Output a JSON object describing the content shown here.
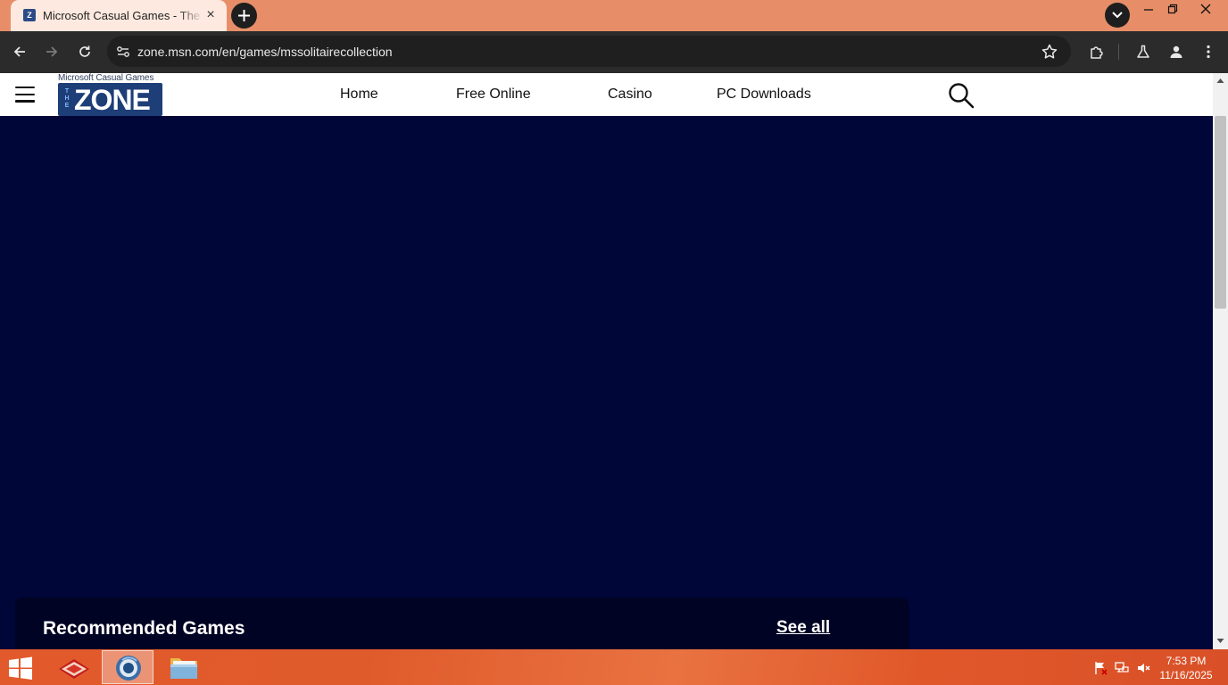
{
  "browser": {
    "tab_title": "Microsoft Casual Games - The Zone",
    "url": "zone.msn.com/en/games/mssolitairecollection"
  },
  "site": {
    "logo_top": "Microsoft Casual Games",
    "logo_the": "THE",
    "logo_zone": "ZONE",
    "nav": [
      "Home",
      "Free Online",
      "Casino",
      "PC Downloads"
    ]
  },
  "content": {
    "section_title": "Recommended Games",
    "see_all": "See all"
  },
  "taskbar": {
    "time": "7:53 PM",
    "date": "11/16/2025"
  },
  "colors": {
    "tab_strip": "#e78e69",
    "page_background": "#000637",
    "panel_background": "#000323",
    "logo_blue": "#1d3e77"
  }
}
